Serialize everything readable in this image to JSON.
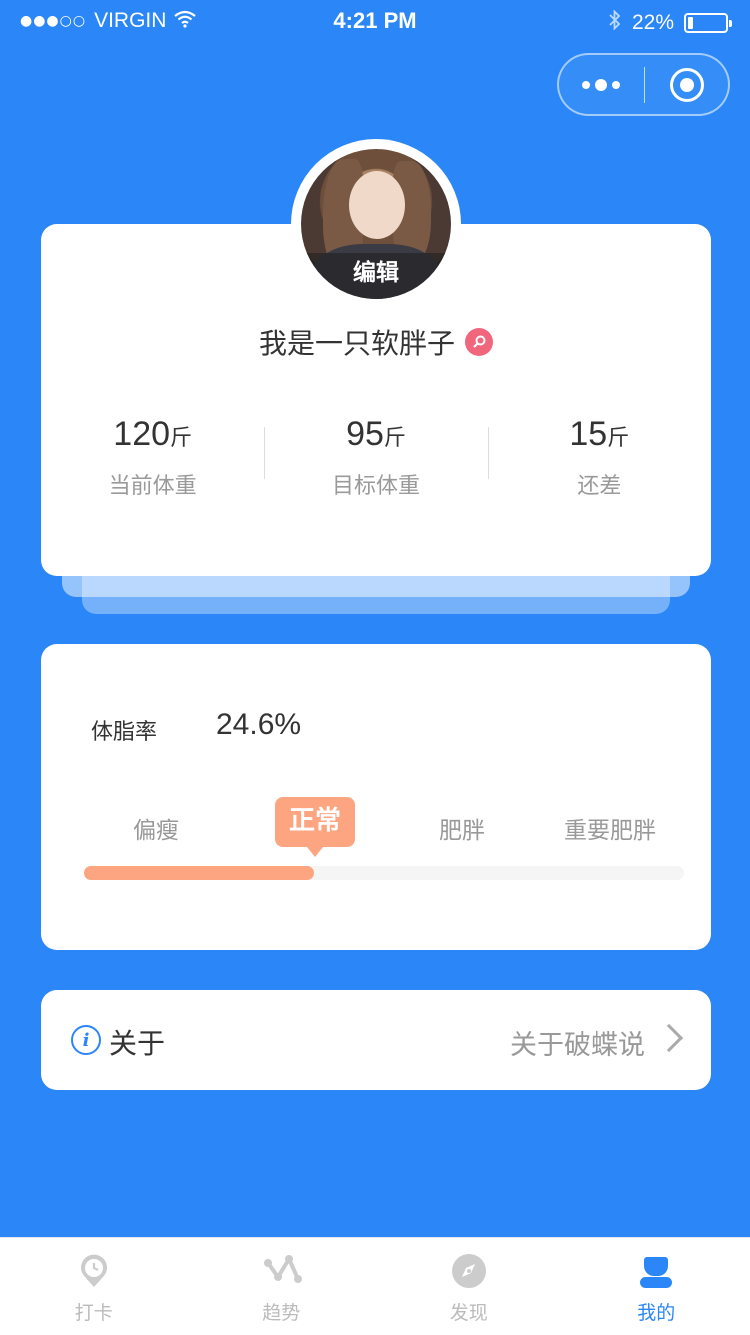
{
  "status_bar": {
    "signal": "●●●○○",
    "carrier": "VIRGIN",
    "time": "4:21 PM",
    "battery_percent": "22%",
    "battery_level": 0.22
  },
  "capsule": {
    "more_icon": "more-dots-icon",
    "close_icon": "target-icon"
  },
  "profile": {
    "avatar_edit": "编辑",
    "nickname": "我是一只软胖子",
    "gender_icon": "female-icon",
    "stats": [
      {
        "value": "120",
        "unit": "斤",
        "label": "当前体重"
      },
      {
        "value": "95",
        "unit": "斤",
        "label": "目标体重"
      },
      {
        "value": "15",
        "unit": "斤",
        "label": "还差"
      }
    ]
  },
  "body_fat": {
    "label": "体脂率",
    "value": "24.6%",
    "categories": [
      "偏瘦",
      "正常",
      "肥胖",
      "重要肥胖"
    ],
    "active_category": "正常",
    "progress": 0.383
  },
  "about": {
    "title": "关于",
    "link": "关于破蝶说"
  },
  "tabbar": {
    "tabs": [
      {
        "label": "打卡",
        "icon": "clock-pin-icon",
        "active": false
      },
      {
        "label": "趋势",
        "icon": "trend-icon",
        "active": false
      },
      {
        "label": "发现",
        "icon": "compass-icon",
        "active": false
      },
      {
        "label": "我的",
        "icon": "user-icon",
        "active": true
      }
    ]
  },
  "colors": {
    "primary": "#2B87F7",
    "accent": "#FCA580",
    "female": "#F0677D"
  }
}
